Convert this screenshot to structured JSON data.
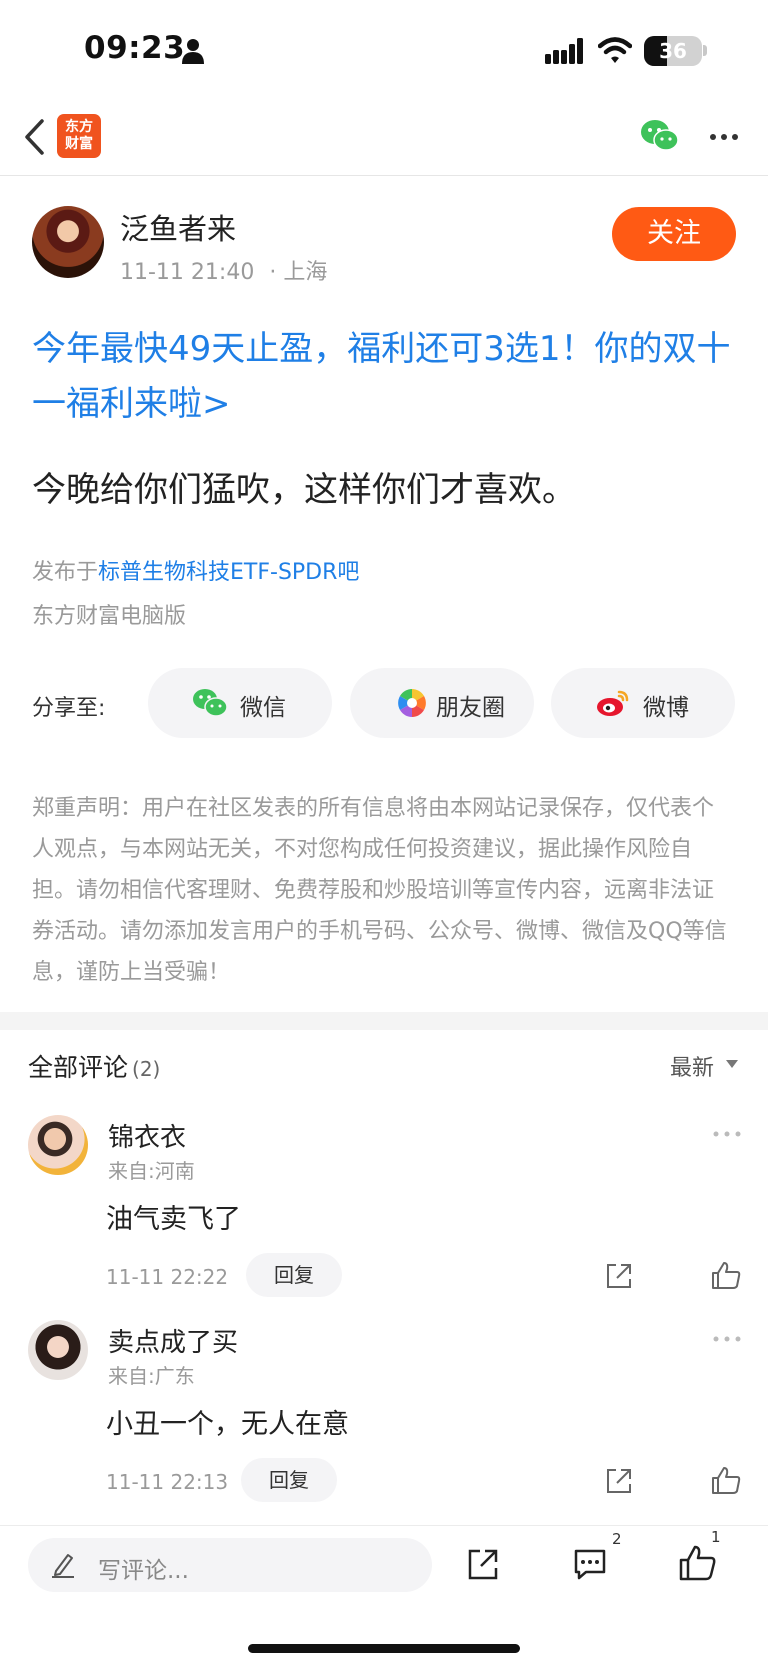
{
  "status_bar": {
    "time": "09:23",
    "battery": "36"
  },
  "nav": {
    "logo_line1": "东方",
    "logo_line2": "财富"
  },
  "post": {
    "author": "泛鱼者来",
    "datetime": "11-11 21:40",
    "location": "· 上海",
    "follow_label": "关注",
    "headline": "今年最快49天止盈，福利还可3选1！你的双十一福利来啦>",
    "content": "今晚给你们猛吹，这样你们才喜欢。",
    "published_prefix": "发布于",
    "forum": "标普生物科技ETF-SPDR吧",
    "client": "东方财富电脑版"
  },
  "share": {
    "label": "分享至:",
    "buttons": [
      {
        "label": "微信",
        "icon": "wechat-icon"
      },
      {
        "label": "朋友圈",
        "icon": "moments-icon"
      },
      {
        "label": "微博",
        "icon": "weibo-icon"
      }
    ]
  },
  "disclaimer": "郑重声明：用户在社区发表的所有信息将由本网站记录保存，仅代表个人观点，与本网站无关，不对您构成任何投资建议，据此操作风险自担。请勿相信代客理财、免费荐股和炒股培训等宣传内容，远离非法证券活动。请勿添加发言用户的手机号码、公众号、微博、微信及QQ等信息，谨防上当受骗！",
  "comments_section": {
    "title": "全部评论",
    "count": "(2)",
    "sort": "最新",
    "items": [
      {
        "name": "锦衣衣",
        "location": "来自:河南",
        "text": "油气卖飞了",
        "time": "11-11 22:22",
        "reply_label": "回复"
      },
      {
        "name": "卖点成了买",
        "location": "来自:广东",
        "text": "小丑一个，无人在意",
        "time": "11-11 22:13",
        "reply_label": "回复"
      }
    ]
  },
  "bottom_bar": {
    "placeholder": "写评论...",
    "comment_count": "2",
    "like_count": "1"
  },
  "colors": {
    "accent": "#ff5a14",
    "link": "#1f7fe6",
    "muted": "#9a9a9a"
  }
}
